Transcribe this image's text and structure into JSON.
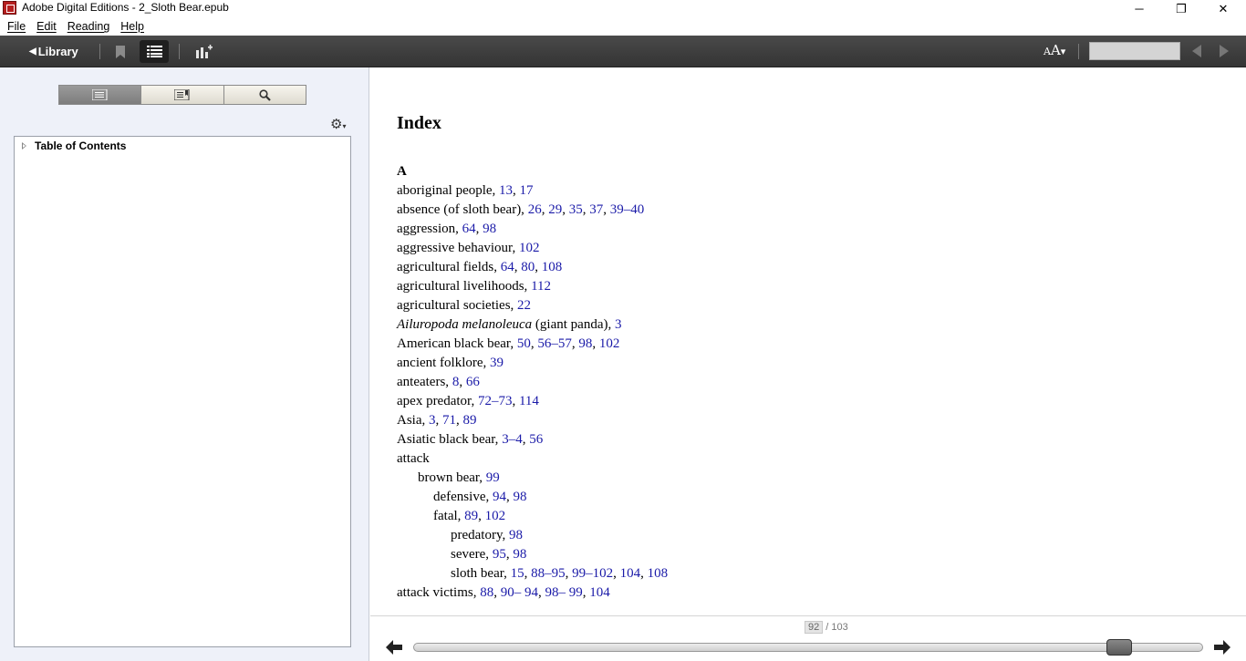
{
  "window": {
    "title": "Adobe Digital Editions - 2_Sloth Bear.epub",
    "minimize": "─",
    "maximize": "❐",
    "close": "✕"
  },
  "menu": {
    "items": [
      "File",
      "Edit",
      "Reading",
      "Help"
    ]
  },
  "toolbar": {
    "library_label": "Library",
    "font_label_big": "A",
    "font_label_small": "A",
    "search_value": ""
  },
  "sidebar": {
    "toc_label": "Table of Contents"
  },
  "content": {
    "heading": "Index",
    "rows": [
      {
        "level": "letter",
        "text": "A"
      },
      {
        "level": "l0",
        "text": "aboriginal people, ",
        "pages": [
          "13",
          "17"
        ]
      },
      {
        "level": "l0",
        "text": "absence (of sloth bear), ",
        "pages": [
          "26",
          "29",
          "35",
          "37",
          "39–40"
        ]
      },
      {
        "level": "l0",
        "text": "aggression, ",
        "pages": [
          "64",
          "98"
        ]
      },
      {
        "level": "l0",
        "text": "aggressive behaviour, ",
        "pages": [
          "102"
        ]
      },
      {
        "level": "l0",
        "text": "agricultural fields, ",
        "pages": [
          "64",
          "80",
          "108"
        ]
      },
      {
        "level": "l0",
        "text": "agricultural livelihoods, ",
        "pages": [
          "112"
        ]
      },
      {
        "level": "l0",
        "text": "agricultural societies, ",
        "pages": [
          "22"
        ]
      },
      {
        "level": "l0",
        "italic": "Ailuropoda melanoleuca",
        "text": " (giant panda), ",
        "pages": [
          "3"
        ]
      },
      {
        "level": "l0",
        "text": "American black bear, ",
        "pages": [
          "50",
          "56–57",
          "98",
          "102"
        ]
      },
      {
        "level": "l0",
        "text": "ancient folklore, ",
        "pages": [
          "39"
        ]
      },
      {
        "level": "l0",
        "text": "anteaters, ",
        "pages": [
          "8",
          "66"
        ]
      },
      {
        "level": "l0",
        "text": "apex predator, ",
        "pages": [
          "72–73",
          "114"
        ]
      },
      {
        "level": "l0",
        "text": "Asia, ",
        "pages": [
          "3",
          "71",
          "89"
        ]
      },
      {
        "level": "l0",
        "text": "Asiatic black bear, ",
        "pages": [
          "3–4",
          "56"
        ]
      },
      {
        "level": "l0",
        "text": "attack",
        "pages": []
      },
      {
        "level": "l1",
        "text": "brown bear, ",
        "pages": [
          "99"
        ]
      },
      {
        "level": "l2",
        "text": "defensive, ",
        "pages": [
          "94",
          "98"
        ]
      },
      {
        "level": "l2",
        "text": "fatal, ",
        "pages": [
          "89",
          "102"
        ]
      },
      {
        "level": "l3",
        "text": "predatory, ",
        "pages": [
          "98"
        ]
      },
      {
        "level": "l3",
        "text": "severe, ",
        "pages": [
          "95",
          "98"
        ]
      },
      {
        "level": "l3",
        "text": "sloth bear, ",
        "pages": [
          "15",
          "88–95",
          "99–102",
          "104",
          "108"
        ]
      },
      {
        "level": "l0",
        "text": "attack victims, ",
        "pages": [
          "88",
          "90– 94",
          "98– 99",
          "104"
        ]
      }
    ]
  },
  "pagination": {
    "current": "92",
    "total_label": "/ 103",
    "progress": 0.8932
  }
}
